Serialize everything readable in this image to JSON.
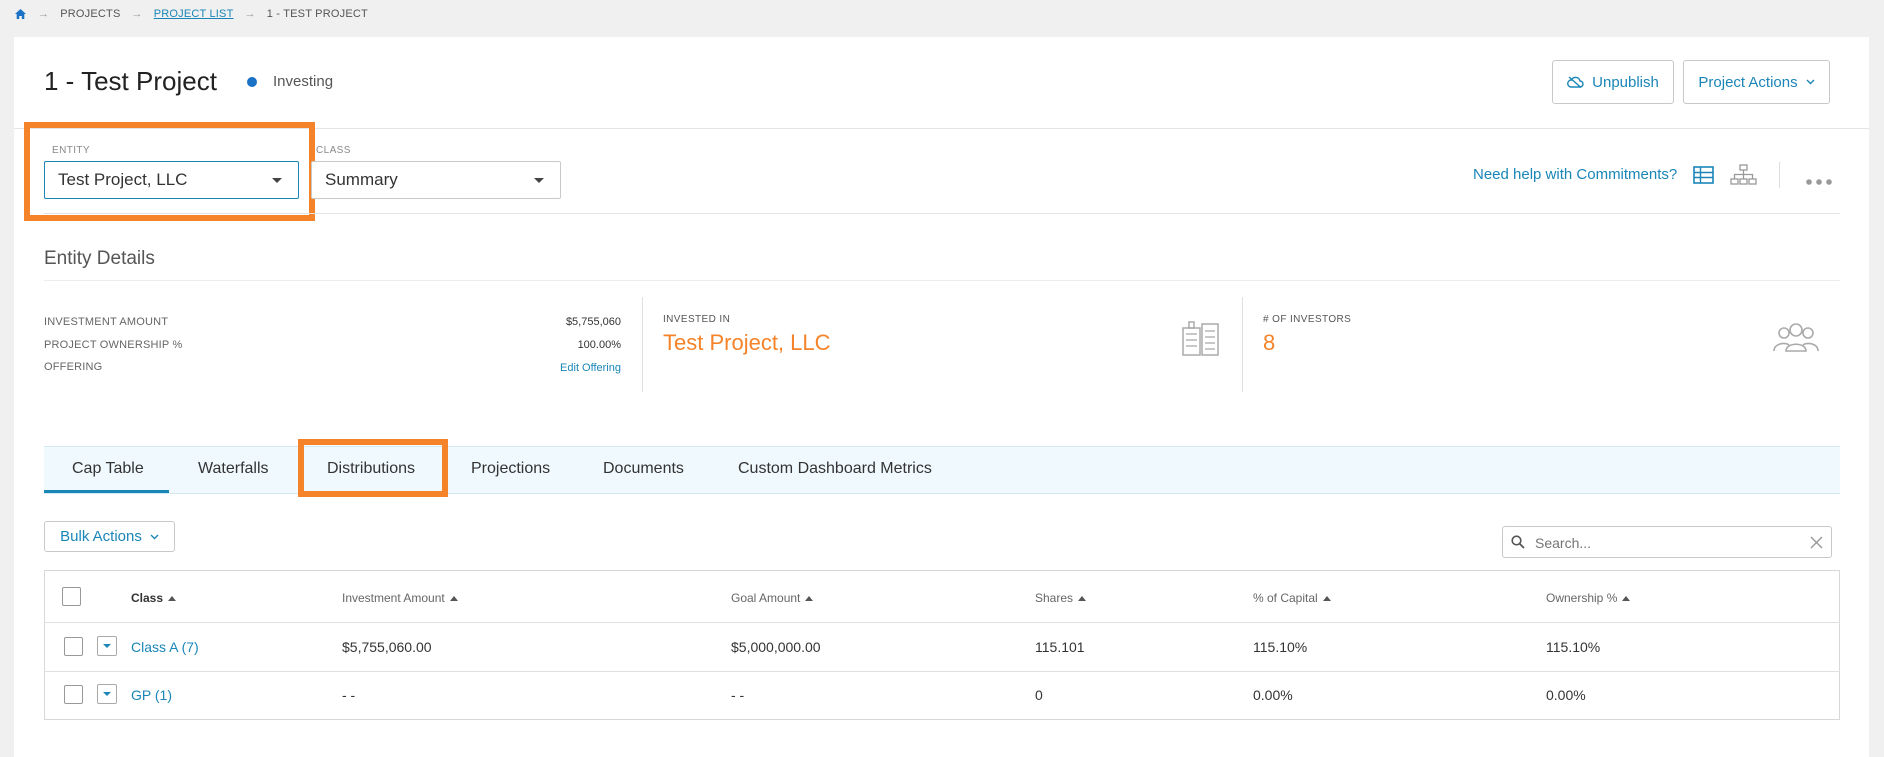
{
  "breadcrumb": {
    "home_icon": "home-icon",
    "items": [
      "PROJECTS",
      "PROJECT LIST",
      "1 - TEST PROJECT"
    ]
  },
  "header": {
    "title": "1 - Test Project",
    "status": "Investing",
    "unpublish_label": "Unpublish",
    "project_actions_label": "Project Actions"
  },
  "filters": {
    "entity_label": "ENTITY",
    "entity_value": "Test Project, LLC",
    "class_label": "CLASS",
    "class_value": "Summary",
    "help_link": "Need help with Commitments?"
  },
  "entity_details": {
    "title": "Entity Details",
    "rows": [
      {
        "label": "INVESTMENT AMOUNT",
        "value": "$5,755,060"
      },
      {
        "label": "PROJECT OWNERSHIP %",
        "value": "100.00%"
      },
      {
        "label": "OFFERING",
        "value": "Edit Offering"
      }
    ],
    "invested_in_label": "INVESTED IN",
    "invested_in_value": "Test Project, LLC",
    "investors_label": "# OF INVESTORS",
    "investors_value": "8"
  },
  "tabs": [
    "Cap Table",
    "Waterfalls",
    "Distributions",
    "Projections",
    "Documents",
    "Custom Dashboard Metrics"
  ],
  "toolbar": {
    "bulk_actions_label": "Bulk Actions",
    "search_placeholder": "Search..."
  },
  "table": {
    "columns": [
      "Class",
      "Investment Amount",
      "Goal Amount",
      "Shares",
      "% of Capital",
      "Ownership %"
    ],
    "rows": [
      {
        "class": "Class A (7)",
        "investment": "$5,755,060.00",
        "goal": "$5,000,000.00",
        "shares": "115.101",
        "capital": "115.10%",
        "ownership": "115.10%"
      },
      {
        "class": "GP (1)",
        "investment": "- -",
        "goal": "- -",
        "shares": "0",
        "capital": "0.00%",
        "ownership": "0.00%"
      }
    ]
  },
  "colors": {
    "accent": "#1a86b8",
    "highlight": "#f5832a",
    "status_dot": "#1a72c6"
  }
}
